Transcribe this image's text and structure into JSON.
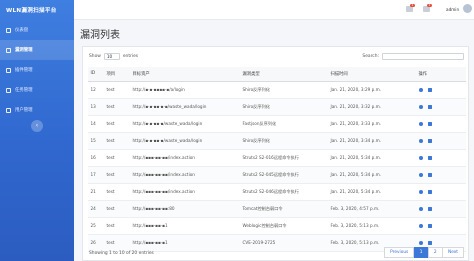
{
  "app": {
    "title": "WLN漏洞扫描平台"
  },
  "sidebar": {
    "items": [
      {
        "label": "仪表盘",
        "active": false
      },
      {
        "label": "漏洞管理",
        "active": true
      },
      {
        "label": "插件管理",
        "active": false
      },
      {
        "label": "任务管理",
        "active": false
      },
      {
        "label": "用户管理",
        "active": false
      }
    ],
    "collapse_icon": "‹"
  },
  "header": {
    "notifications_count": "1",
    "messages_count": "1",
    "user": "admin"
  },
  "page": {
    "title": "漏洞列表"
  },
  "table_controls": {
    "show_label": "Show",
    "page_size": "10",
    "entries_label": "entries",
    "search_label": "Search:"
  },
  "table": {
    "columns": [
      "ID",
      "项目",
      "目标资产",
      "漏洞类型",
      "扫描时间",
      "操作"
    ],
    "rows": [
      {
        "id": "12",
        "project": "test",
        "target": "http://▪·▪·▪▪▪▪·▪/a/login",
        "vuln": "Shiro反序列化",
        "time": "Jan. 21, 2020, 3:29 p.m."
      },
      {
        "id": "13",
        "project": "test",
        "target": "http://▪·▪·▪▪·▪·▪/waste_wada/login",
        "vuln": "Shiro反序列化",
        "time": "Jan. 21, 2020, 3:32 p.m."
      },
      {
        "id": "14",
        "project": "test",
        "target": "http://▪·▪·▪▪·▪/waste_wada/login",
        "vuln": "Fastjson反序列化",
        "time": "Jan. 21, 2020, 3:33 p.m."
      },
      {
        "id": "15",
        "project": "test",
        "target": "http://▪·▪·▪▪·▪/waste_wada/login",
        "vuln": "Shiro反序列化",
        "time": "Jan. 21, 2020, 3:34 p.m."
      },
      {
        "id": "16",
        "project": "test",
        "target": "http://▪▪▪·▪▪·▪▪/index.action",
        "vuln": "Struts2 S2-016远程命令执行",
        "time": "Jan. 21, 2020, 5:34 p.m."
      },
      {
        "id": "17",
        "project": "test",
        "target": "http://▪▪▪·▪▪·▪▪/index.action",
        "vuln": "Struts2 S2-045远程命令执行",
        "time": "Jan. 21, 2020, 5:34 p.m."
      },
      {
        "id": "21",
        "project": "test",
        "target": "http://▪▪▪·▪▪·▪▪/index.action",
        "vuln": "Struts2 S2-046远程命令执行",
        "time": "Jan. 21, 2020, 5:34 p.m."
      },
      {
        "id": "24",
        "project": "test",
        "target": "http://▪▪▪·▪▪·▪▪:80",
        "vuln": "Tomcat控制台弱口令",
        "time": "Feb. 3, 2020, 4:57 p.m."
      },
      {
        "id": "25",
        "project": "test",
        "target": "http://▪▪▪·▪▪·▪1",
        "vuln": "Weblogic控制台弱口令",
        "time": "Feb. 3, 2020, 5:13 p.m."
      },
      {
        "id": "26",
        "project": "test",
        "target": "http://▪▪▪·▪▪·▪1",
        "vuln": "CVE-2019-2725",
        "time": "Feb. 3, 2020, 5:13 p.m."
      }
    ]
  },
  "footer": {
    "info": "Showing 1 to 10 of 20 entries",
    "previous": "Previous",
    "page1": "1",
    "page2": "2",
    "next": "Next"
  },
  "colors": {
    "sidebar": "#3068cf",
    "accent": "#3c78d8",
    "badge": "#e84c3d"
  }
}
